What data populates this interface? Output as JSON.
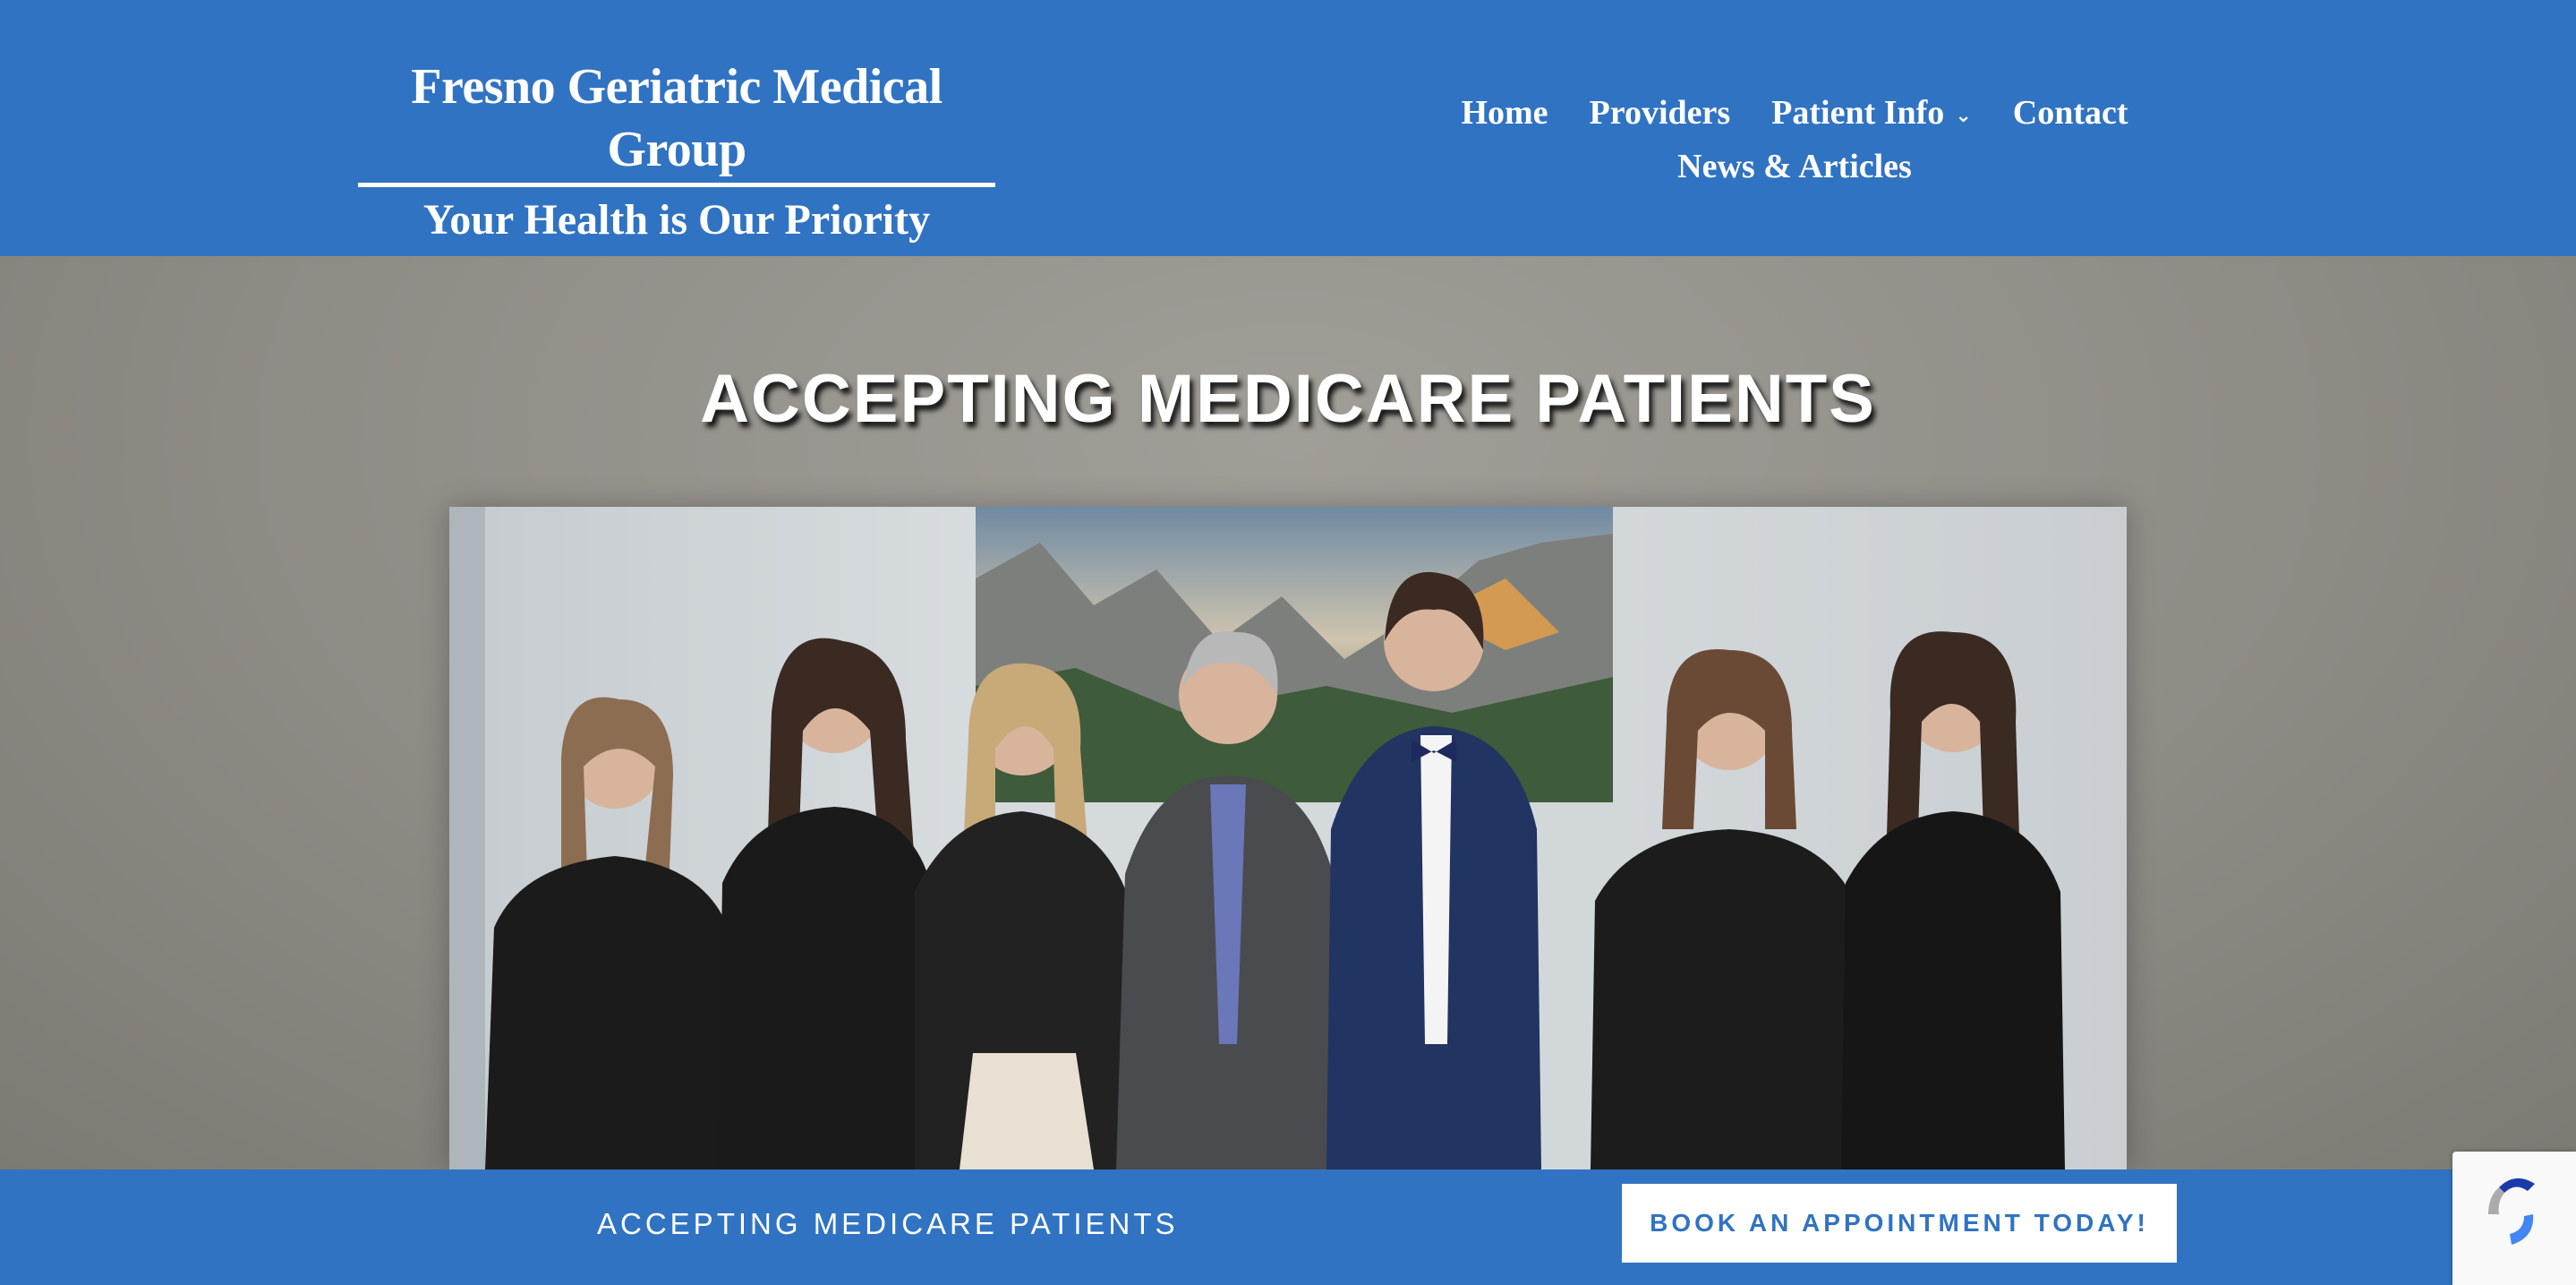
{
  "header": {
    "logo_title": "Fresno Geriatric Medical Group",
    "logo_tagline": "Your Health is Our Priority"
  },
  "nav": {
    "items": [
      {
        "label": "Home"
      },
      {
        "label": "Providers"
      },
      {
        "label": "Patient Info"
      },
      {
        "label": "Contact"
      },
      {
        "label": "News & Articles"
      }
    ]
  },
  "hero": {
    "title": "ACCEPTING MEDICARE PATIENTS"
  },
  "cta_bar": {
    "text": "ACCEPTING MEDICARE PATIENTS",
    "button_label": "BOOK AN APPOINTMENT TODAY!"
  },
  "colors": {
    "brand_blue": "#3073c2",
    "hero_background": "#8f8c86"
  },
  "icons": {
    "dropdown": "chevron-down-icon",
    "recaptcha": "recaptcha-icon"
  }
}
